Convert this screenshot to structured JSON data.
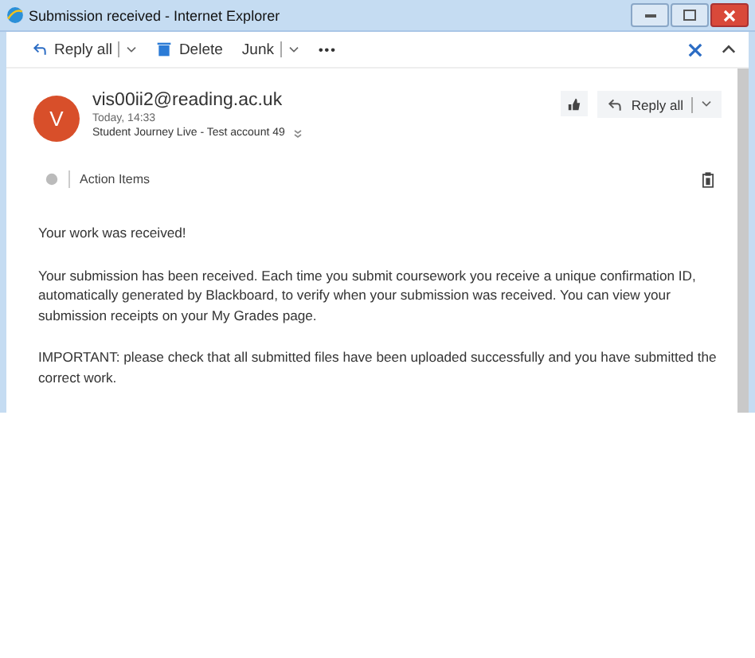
{
  "window": {
    "title": "Submission received - Internet Explorer"
  },
  "toolbar": [
    {
      "kind": "reply",
      "label": "Reply all"
    },
    {
      "kind": "delete",
      "label": "Delete"
    },
    {
      "kind": "junk",
      "label": "Junk"
    },
    {
      "kind": "more",
      "label": "•••"
    }
  ],
  "message": {
    "avatar": "V",
    "sender": "vis00ii2@reading.ac.uk",
    "time": "Today, 14:33",
    "to": "Student Journey Live - Test account 49",
    "reply_button": "Reply all",
    "action_items": "Action Items",
    "body": [
      "Your work was received!",
      "Your submission has been received. Each time you submit coursework you receive a unique confirmation ID, automatically generated by Blackboard, to verify when your submission was received. You can view your submission receipts on your My Grades page.",
      "IMPORTANT: please check that all submitted files have been uploaded successfully and you have submitted the correct work."
    ]
  }
}
